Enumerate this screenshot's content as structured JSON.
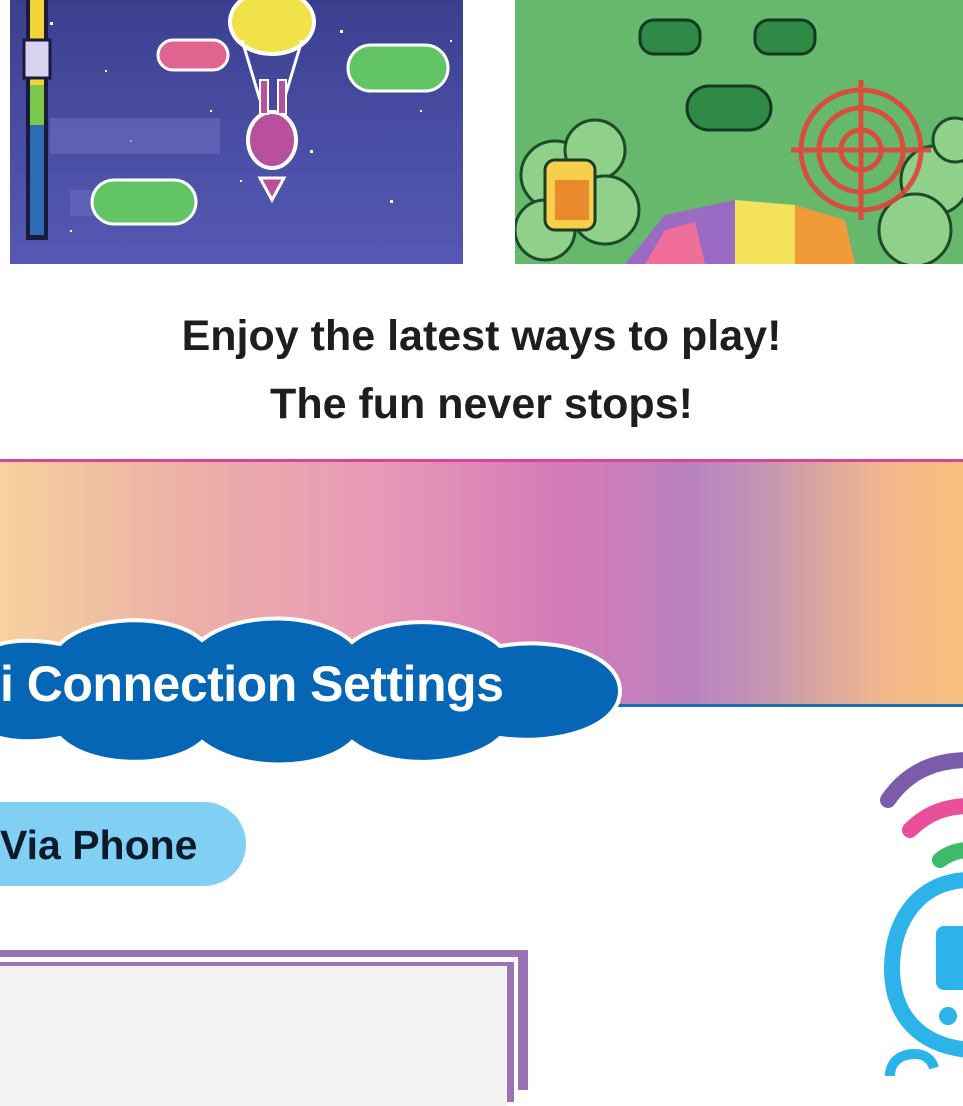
{
  "caption": {
    "line1": "Enjoy the latest ways to play!",
    "line2": "The fun never stops!"
  },
  "section": {
    "heading": "i Connection Settings",
    "subheading": "Via Phone"
  },
  "colors": {
    "divider": "#d9449a",
    "heading_bg": "#0566b6",
    "pill_bg": "#7fd0f2",
    "frame": "#9a73b4",
    "wifi_purple": "#7a5cab",
    "wifi_pink": "#e94f9a",
    "wifi_green": "#3dbb6b",
    "wifi_blue": "#2bb3ea"
  },
  "icons": {
    "game_left": "space-balloon-game-screenshot",
    "game_right": "target-shooting-game-screenshot",
    "wifi": "wifi-connection-icon"
  }
}
